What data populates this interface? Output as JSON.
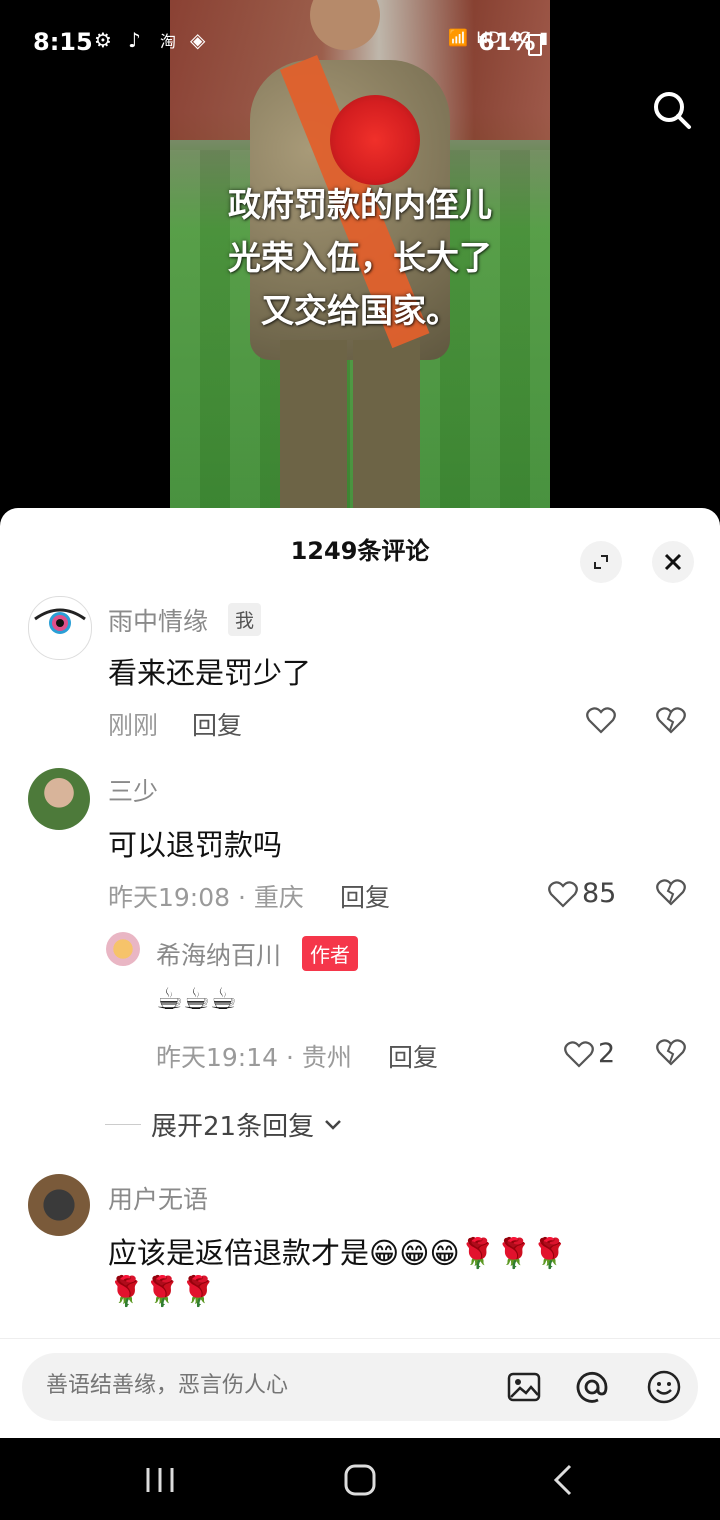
{
  "status_bar": {
    "time": "8:15",
    "network": "HD",
    "signal_label": "4G",
    "battery": "61%"
  },
  "video": {
    "caption_lines": [
      "政府罚款的内侄儿",
      "光荣入伍，长大了",
      "又交给国家。"
    ]
  },
  "sheet": {
    "title": "1249条评论"
  },
  "comments": [
    {
      "username": "雨中情缘",
      "badge": "我",
      "text": "看来还是罚少了",
      "time": "刚刚",
      "reply_label": "回复"
    },
    {
      "username": "三少",
      "text": "可以退罚款吗",
      "time_location": "昨天19:08 · 重庆",
      "reply_label": "回复",
      "likes": "85"
    },
    {
      "username": "用户无语",
      "text_line1": "应该是返倍退款才是😁😁😁🌹🌹🌹",
      "text_line2": "🌹🌹🌹"
    }
  ],
  "sub_reply": {
    "username": "希海纳百川",
    "badge": "作者",
    "text": "☕☕☕",
    "time_location": "昨天19:14 · 贵州",
    "reply_label": "回复",
    "likes": "2"
  },
  "expand_replies": {
    "label": "展开21条回复"
  },
  "composer": {
    "placeholder": "善语结善缘，恶言伤人心"
  },
  "colors": {
    "author_badge": "#f5364a",
    "sheet_bg": "#ffffff",
    "muted_text": "#8a8a8a"
  }
}
